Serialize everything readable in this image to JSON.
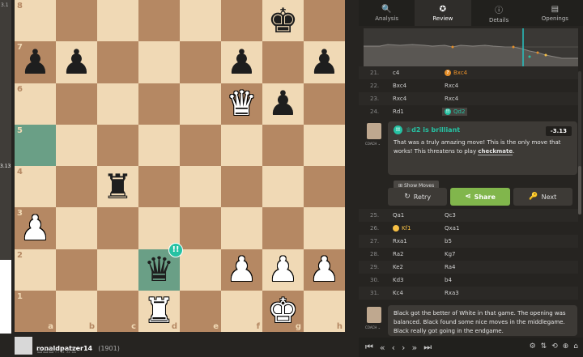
{
  "eval": {
    "top_label": "3.1",
    "mid_label": "3.13",
    "white_fraction": 0.22
  },
  "board": {
    "files": [
      "a",
      "b",
      "c",
      "d",
      "e",
      "f",
      "g",
      "h"
    ],
    "ranks": [
      "8",
      "7",
      "6",
      "5",
      "4",
      "3",
      "2",
      "1"
    ],
    "pieces": {
      "g8": "bk",
      "a7": "bp",
      "b7": "bp",
      "f7": "bp",
      "h7": "bp",
      "f6": "wq",
      "g6": "bp",
      "c4": "br",
      "a3": "wp",
      "d2": "bq",
      "f2": "wp",
      "g2": "wp",
      "h2": "wp",
      "d1": "wr",
      "g1": "wk"
    },
    "highlight": [
      "a5",
      "d2"
    ],
    "brilliant_square": "d2",
    "brilliant_symbol": "!!"
  },
  "player": {
    "name": "ronaldpatzer14",
    "rating": "(1901)",
    "captured": "♙♙♙♘♗♗♖"
  },
  "tabs": [
    {
      "label": "Analysis",
      "icon": "🔍",
      "active": false
    },
    {
      "label": "Review",
      "icon": "✪",
      "active": true
    },
    {
      "label": "Details",
      "icon": "ⓘ",
      "active": false
    },
    {
      "label": "Openings",
      "icon": "▤",
      "active": false
    }
  ],
  "moves_top": [
    {
      "num": "21.",
      "white": "c4",
      "black": "Bxc4",
      "black_mark": "orange",
      "black_mark_symbol": "?"
    },
    {
      "num": "22.",
      "white": "Bxc4",
      "black": "Rxc4"
    },
    {
      "num": "23.",
      "white": "Rxc4",
      "black": "Rxc4"
    },
    {
      "num": "24.",
      "white": "Rd1",
      "black": "Qd2",
      "black_mark": "teal",
      "black_mark_symbol": "!!",
      "black_selected": true
    }
  ],
  "coach": {
    "label": "COACH ⌄",
    "headline": "♕d2 is brilliant",
    "badge": "!!",
    "score": "-3.13",
    "text_before": "That was a truly amazing move! This is the only move that works! This threatens to play ",
    "text_link": "checkmate",
    "text_after": ".",
    "show_moves": "Show Moves"
  },
  "actions": {
    "retry": "Retry",
    "retry_icon": "↻",
    "share": "Share",
    "share_icon": "⋖",
    "next": "Next",
    "next_icon": "🔑"
  },
  "moves_bottom": [
    {
      "num": "25.",
      "white": "Qa1",
      "black": "Qc3"
    },
    {
      "num": "26.",
      "white": "Kf1",
      "white_mark": "yellow",
      "white_mark_symbol": "",
      "black": "Qxa1"
    },
    {
      "num": "27.",
      "white": "Rxa1",
      "black": "b5"
    },
    {
      "num": "28.",
      "white": "Ra2",
      "black": "Kg7"
    },
    {
      "num": "29.",
      "white": "Ke2",
      "black": "Ra4"
    },
    {
      "num": "30.",
      "white": "Kd3",
      "black": "b4"
    },
    {
      "num": "31.",
      "white": "Kc4",
      "black": "Rxa3"
    }
  ],
  "coach2": {
    "label": "COACH ⌄",
    "text": "Black got the better of White in that game. The opening was balanced. Black found some nice moves in the middlegame. Black really got going in the endgame."
  },
  "controls": [
    "⏮",
    "«",
    "‹",
    "›",
    "»",
    "⏭"
  ],
  "controls_right": [
    "⚙",
    "⇅",
    "⟲",
    "⊕",
    "⌂"
  ]
}
